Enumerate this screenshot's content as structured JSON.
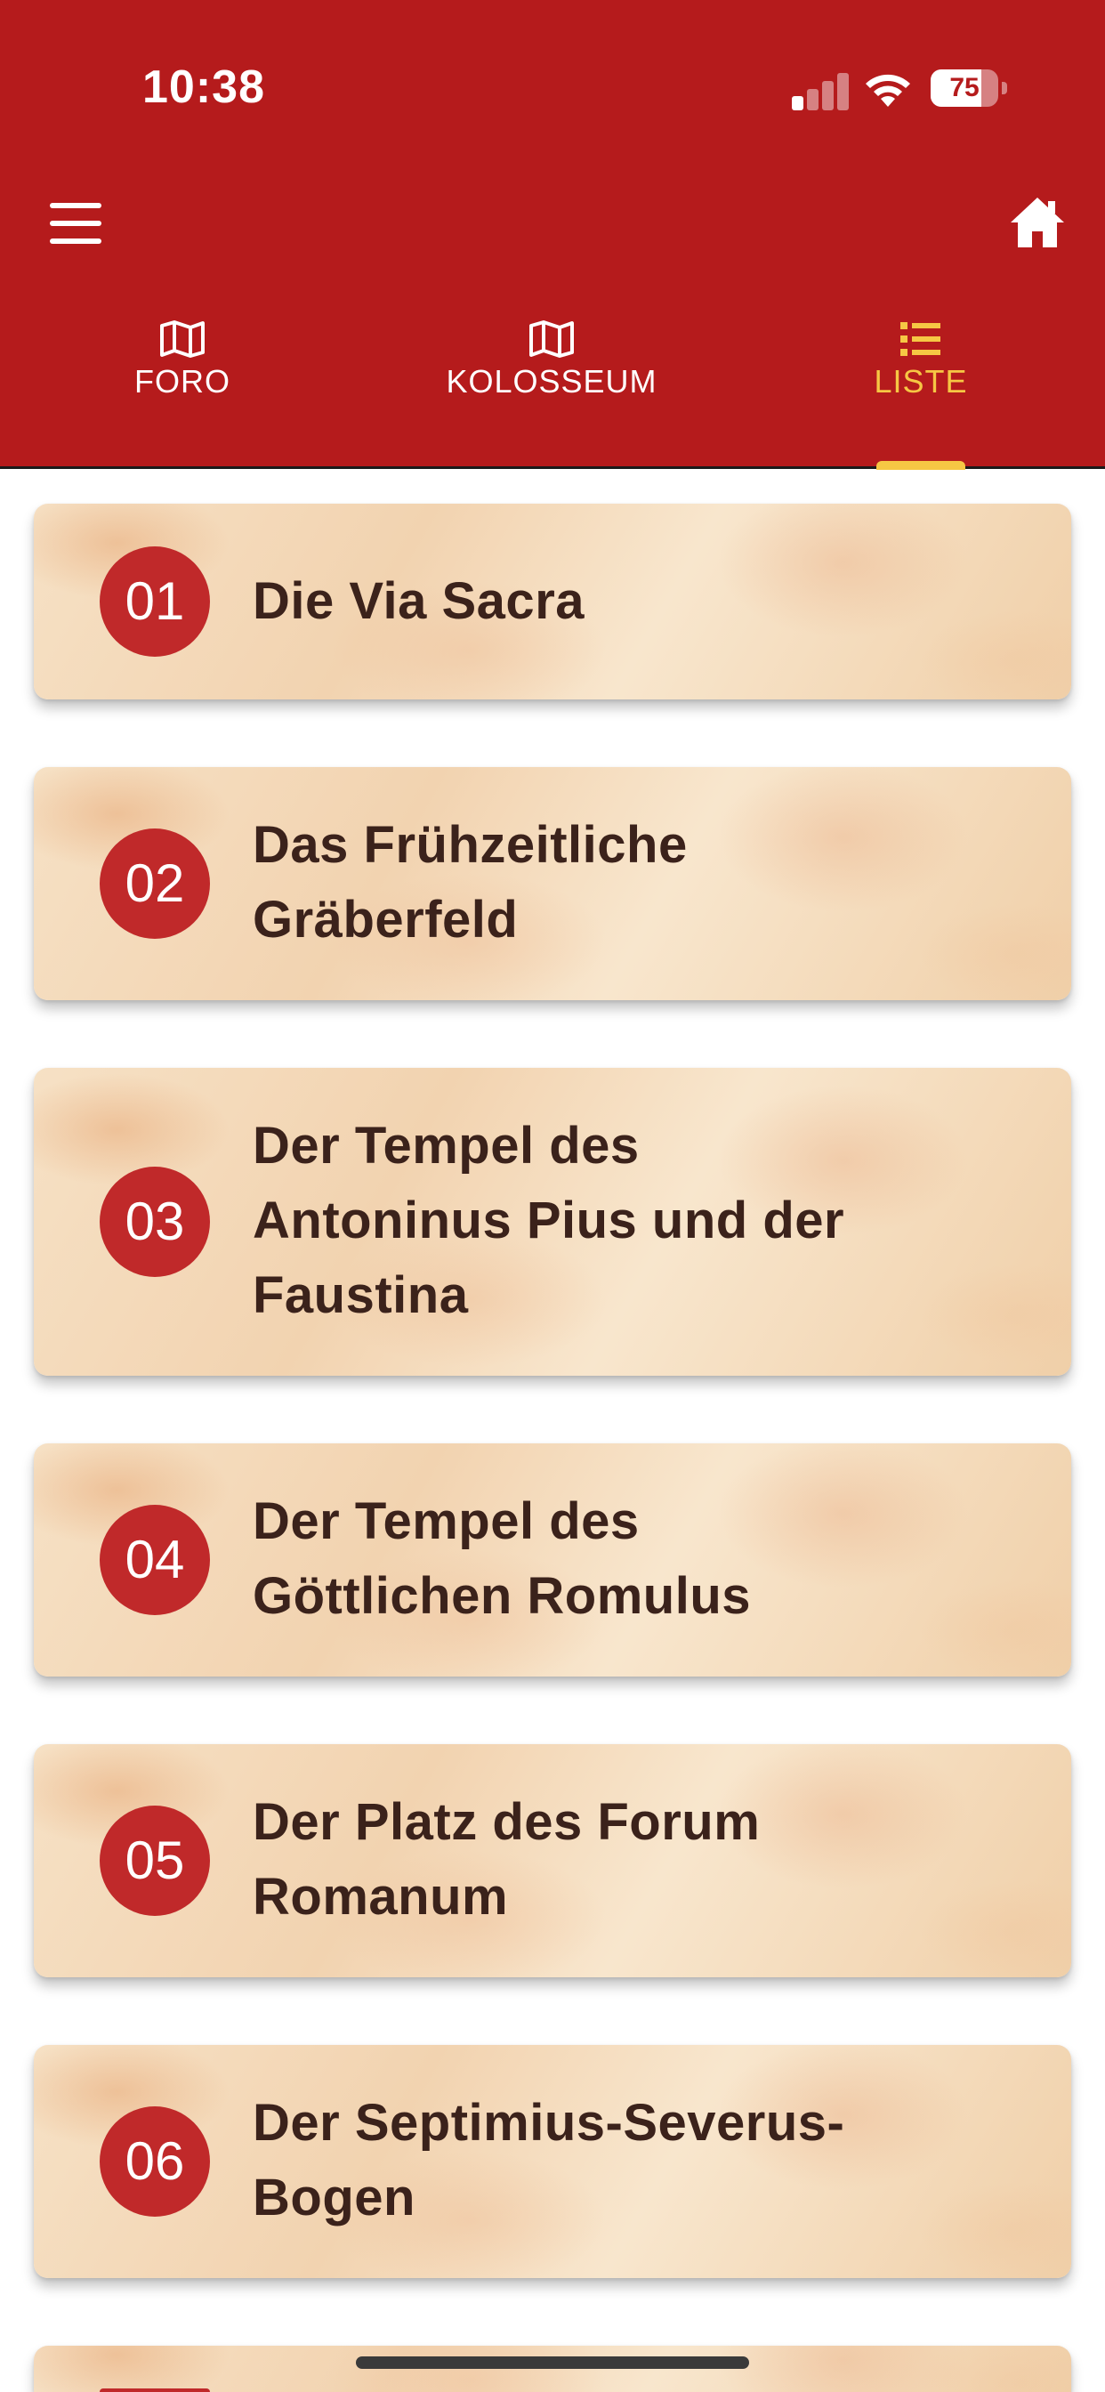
{
  "status_bar": {
    "time": "10:38",
    "battery": "75",
    "battery_level": 0.75
  },
  "toolbar": {
    "menu_icon": "hamburger-menu-icon",
    "home_icon": "home-icon"
  },
  "tabs": [
    {
      "label": "FORO",
      "icon": "map-icon",
      "active": false
    },
    {
      "label": "KOLOSSEUM",
      "icon": "map-icon",
      "active": false
    },
    {
      "label": "LISTE",
      "icon": "list-icon",
      "active": true
    }
  ],
  "colors": {
    "header": "#b51b1c",
    "accent": "#f6c744",
    "badge": "#c0292a",
    "title_text": "#3b221b"
  },
  "items": [
    {
      "number": "01",
      "title_lines": [
        "Die Via Sacra"
      ]
    },
    {
      "number": "02",
      "title_lines": [
        "Das Frühzeitliche",
        "Gräberfeld"
      ]
    },
    {
      "number": "03",
      "title_lines": [
        "Der Tempel des",
        "Antoninus Pius und der",
        "Faustina"
      ]
    },
    {
      "number": "04",
      "title_lines": [
        "Der Tempel des",
        "Göttlichen Romulus"
      ]
    },
    {
      "number": "05",
      "title_lines": [
        "Der Platz des Forum",
        "Romanum"
      ]
    },
    {
      "number": "06",
      "title_lines": [
        "Der Septimius-Severus-",
        "Bogen"
      ]
    }
  ]
}
